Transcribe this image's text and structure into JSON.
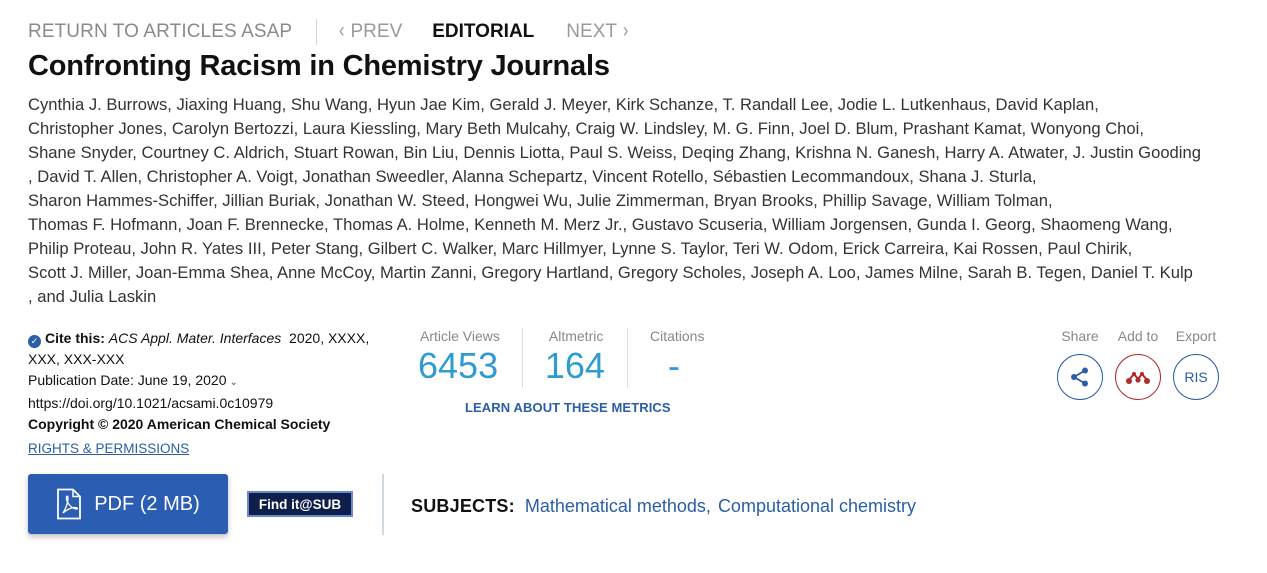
{
  "nav": {
    "return_label": "RETURN TO ARTICLES ASAP",
    "prev_label": "PREV",
    "current_label": "EDITORIAL",
    "next_label": "NEXT"
  },
  "article": {
    "title": "Confronting Racism in Chemistry Journals",
    "author_lines": [
      "Cynthia J. Burrows, Jiaxing Huang, Shu Wang, Hyun Jae Kim, Gerald J. Meyer, Kirk Schanze, T. Randall Lee, Jodie L. Lutkenhaus, David Kaplan,",
      "Christopher Jones, Carolyn Bertozzi, Laura Kiessling, Mary Beth Mulcahy, Craig W. Lindsley, M. G. Finn, Joel D. Blum, Prashant Kamat, Wonyong Choi,",
      "Shane Snyder, Courtney C. Aldrich, Stuart Rowan, Bin Liu, Dennis Liotta, Paul S. Weiss, Deqing Zhang, Krishna N. Ganesh, Harry A. Atwater, J. Justin Gooding",
      ", David T. Allen, Christopher A. Voigt, Jonathan Sweedler, Alanna Schepartz, Vincent Rotello, Sébastien Lecommandoux, Shana J. Sturla,",
      "Sharon Hammes-Schiffer, Jillian Buriak, Jonathan W. Steed, Hongwei Wu, Julie Zimmerman, Bryan Brooks, Phillip Savage, William Tolman,",
      "Thomas F. Hofmann, Joan F. Brennecke, Thomas A. Holme, Kenneth M. Merz Jr., Gustavo Scuseria, William Jorgensen, Gunda I. Georg, Shaomeng Wang,",
      "Philip Proteau, John R. Yates III, Peter Stang, Gilbert C. Walker, Marc Hillmyer, Lynne S. Taylor, Teri W. Odom, Erick Carreira, Kai Rossen, Paul Chirik,",
      "Scott J. Miller, Joan-Emma Shea, Anne McCoy, Martin Zanni, Gregory Hartland, Gregory Scholes, Joseph A. Loo, James Milne, Sarah B. Tegen, Daniel T. Kulp",
      ", and Julia Laskin"
    ]
  },
  "citation": {
    "cite_label": "Cite this:",
    "journal": "ACS Appl. Mater. Interfaces",
    "cite_rest_1": "2020, XXXX,",
    "cite_rest_2": "XXX, XXX-XXX",
    "pub_date": "Publication Date: June 19, 2020",
    "doi": "https://doi.org/10.1021/acsami.0c10979",
    "copyright": "Copyright © 2020 American Chemical Society",
    "rights_link": "RIGHTS & PERMISSIONS"
  },
  "metrics": {
    "views_label": "Article Views",
    "views_value": "6453",
    "altmetric_label": "Altmetric",
    "altmetric_value": "164",
    "citations_label": "Citations",
    "citations_value": "-",
    "learn_link": "LEARN ABOUT THESE METRICS"
  },
  "actions": {
    "share_label": "Share",
    "addto_label": "Add to",
    "export_label": "Export",
    "export_button": "RIS"
  },
  "buttons": {
    "pdf_label": "PDF (2 MB)",
    "findit_label": "Find it@SUB"
  },
  "subjects": {
    "label": "SUBJECTS:",
    "items": [
      "Mathematical methods",
      "Computational chemistry"
    ],
    "separator": ","
  },
  "colors": {
    "accent": "#2a5ea8",
    "metric_value": "#2f9bd3",
    "mendeley_red": "#b22a2a",
    "pdf_button": "#2b5db2"
  },
  "icons": [
    "chevron-left-icon",
    "chevron-right-icon",
    "check-circle-icon",
    "caret-down-icon",
    "share-icon",
    "mendeley-icon",
    "pdf-file-icon"
  ]
}
